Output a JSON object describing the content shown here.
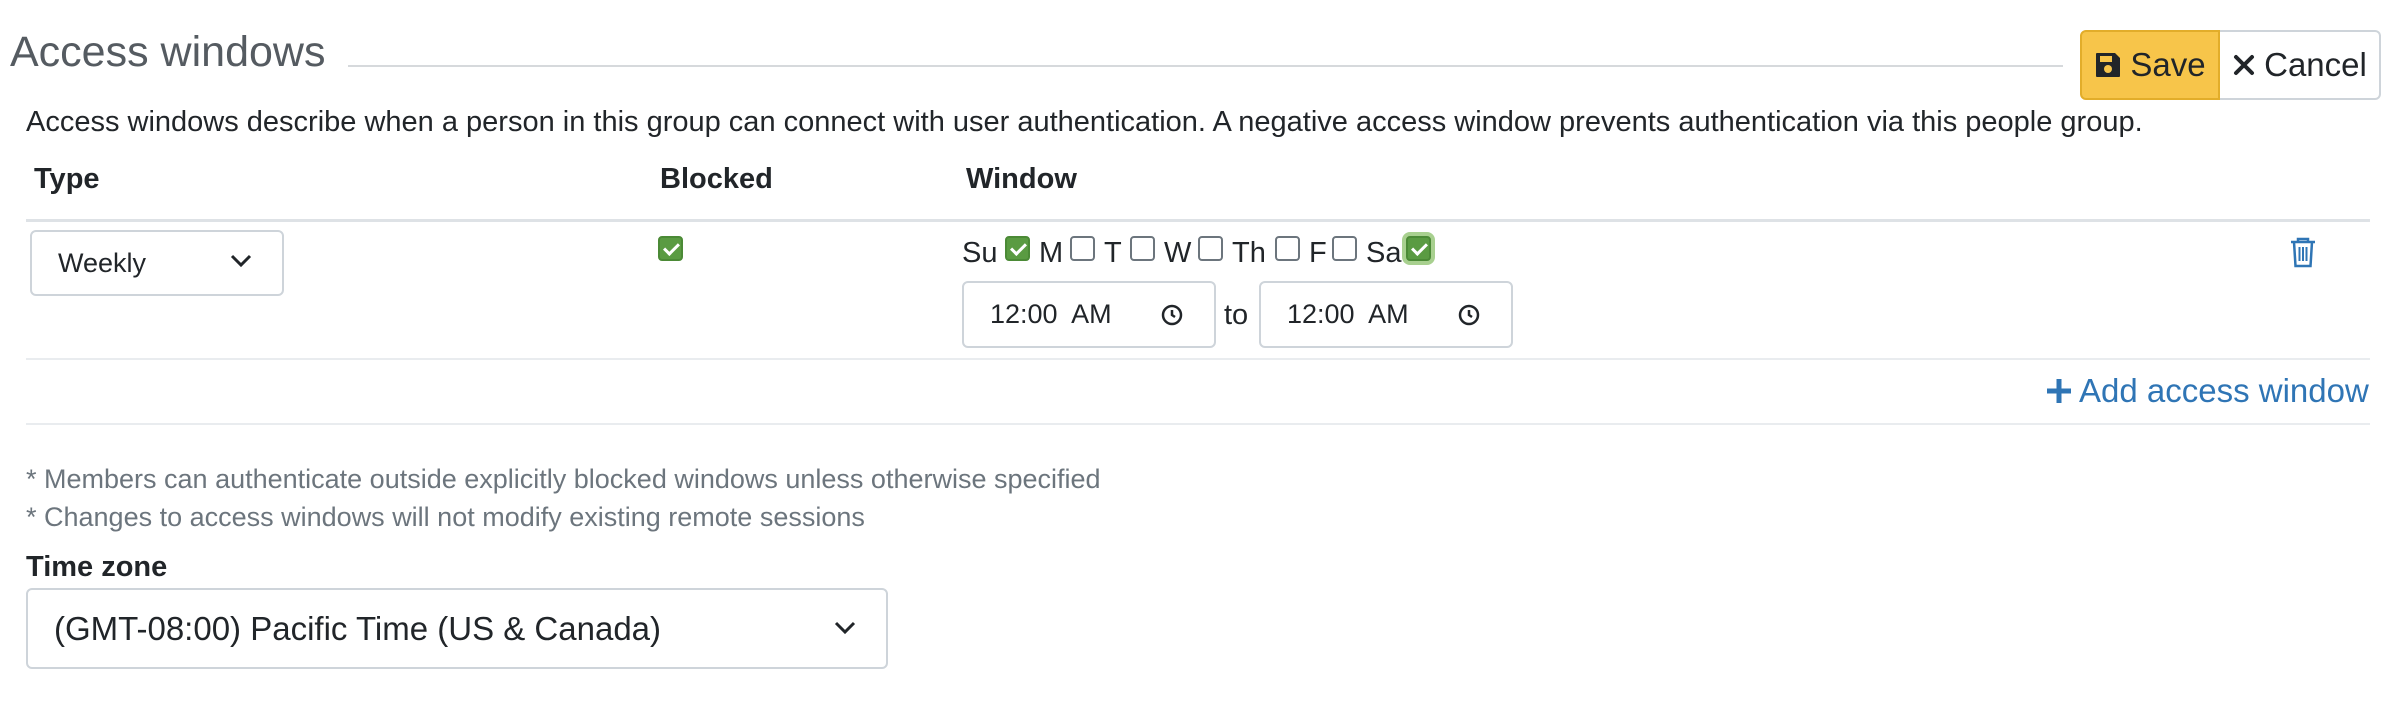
{
  "header": {
    "title": "Access windows",
    "save_label": "Save",
    "cancel_label": "Cancel"
  },
  "description": "Access windows describe when a person in this group can connect with user authentication. A negative access window prevents authentication via this people group.",
  "table": {
    "columns": [
      "Type",
      "Blocked",
      "Window"
    ],
    "rows": [
      {
        "type": "Weekly",
        "blocked": true,
        "days": [
          {
            "label": "Su",
            "checked": true
          },
          {
            "label": "M",
            "checked": false
          },
          {
            "label": "T",
            "checked": false
          },
          {
            "label": "W",
            "checked": false
          },
          {
            "label": "Th",
            "checked": false
          },
          {
            "label": "F",
            "checked": false
          },
          {
            "label": "Sa",
            "checked": true
          }
        ],
        "start_time": "12:00  AM",
        "to_label": "to",
        "end_time": "12:00  AM"
      }
    ]
  },
  "add_window_label": "Add access window",
  "notes": [
    "* Members can authenticate outside explicitly blocked windows unless otherwise specified",
    "* Changes to access windows will not modify existing remote sessions"
  ],
  "timezone": {
    "label": "Time zone",
    "value": "(GMT-08:00) Pacific Time (US & Canada)"
  },
  "colors": {
    "accent": "#2f75b5",
    "save_button": "#f7c54a",
    "checkbox_checked": "#5a9b42"
  },
  "icons": {
    "save": "floppy-disk-icon",
    "cancel": "close-icon",
    "type_dropdown": "chevron-down-icon",
    "time": "clock-icon",
    "delete": "trash-icon",
    "add": "plus-icon",
    "timezone_dropdown": "chevron-down-icon"
  }
}
